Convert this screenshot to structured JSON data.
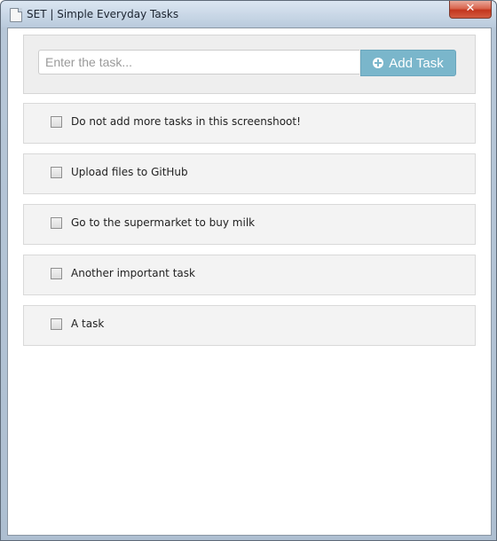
{
  "window": {
    "title": "SET | Simple Everyday Tasks",
    "close_glyph": "✕"
  },
  "input": {
    "placeholder": "Enter the task...",
    "value": ""
  },
  "add_button": {
    "label": "Add Task",
    "icon": "plus-circle-icon",
    "color": "#7ab6cb"
  },
  "tasks": [
    {
      "label": "Do not add more tasks in this screenshoot!",
      "checked": false
    },
    {
      "label": "Upload files to GitHub",
      "checked": false
    },
    {
      "label": "Go to the supermarket to buy milk",
      "checked": false
    },
    {
      "label": "Another important task",
      "checked": false
    },
    {
      "label": "A task",
      "checked": false
    }
  ]
}
